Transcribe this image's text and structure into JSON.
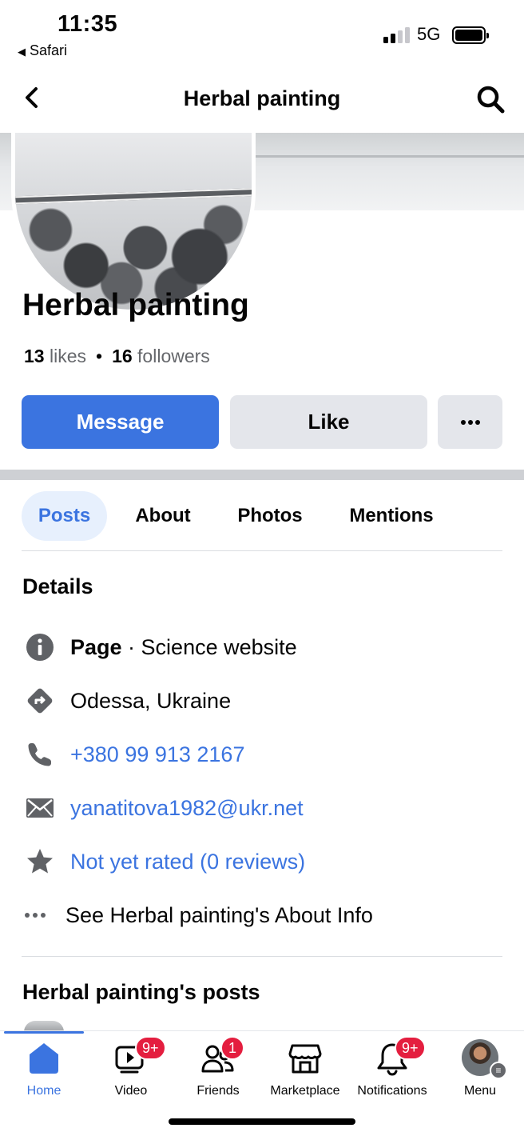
{
  "status_bar": {
    "time": "11:35",
    "back_app": "Safari",
    "network": "5G"
  },
  "header": {
    "title": "Herbal painting"
  },
  "page": {
    "name": "Herbal painting",
    "likes_count": "13",
    "likes_label": "likes",
    "followers_count": "16",
    "followers_label": "followers"
  },
  "actions": {
    "message": "Message",
    "like": "Like",
    "more": "•••"
  },
  "tabs": [
    {
      "label": "Posts",
      "active": true
    },
    {
      "label": "About",
      "active": false
    },
    {
      "label": "Photos",
      "active": false
    },
    {
      "label": "Mentions",
      "active": false
    }
  ],
  "details": {
    "title": "Details",
    "category_prefix": "Page",
    "category": " · Science website",
    "location": "Odessa, Ukraine",
    "phone": "+380 99 913 2167",
    "email": "yanatitova1982@ukr.net",
    "rating": "Not yet rated (0 reviews)",
    "see_about": "See Herbal painting's About Info"
  },
  "posts_section": {
    "title": "Herbal painting's posts"
  },
  "tabbar": {
    "items": [
      {
        "label": "Home",
        "icon": "home-icon",
        "badge": ""
      },
      {
        "label": "Video",
        "icon": "video-icon",
        "badge": "9+"
      },
      {
        "label": "Friends",
        "icon": "friends-icon",
        "badge": "1"
      },
      {
        "label": "Marketplace",
        "icon": "marketplace-icon",
        "badge": ""
      },
      {
        "label": "Notifications",
        "icon": "bell-icon",
        "badge": "9+"
      },
      {
        "label": "Menu",
        "icon": "menu-avatar-icon",
        "badge": ""
      }
    ]
  },
  "colors": {
    "accent": "#3b74e0",
    "badge": "#e41e3f",
    "secondary_button": "#e4e6eb"
  }
}
